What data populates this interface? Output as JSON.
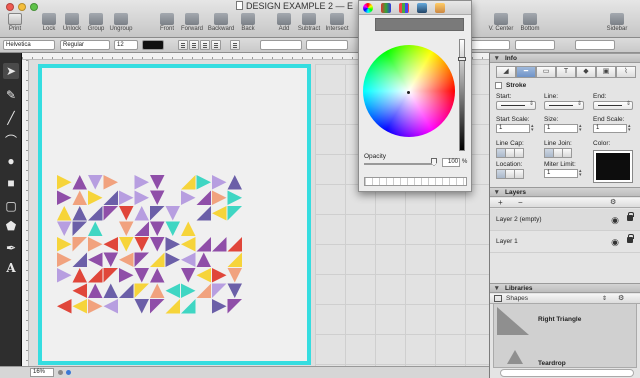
{
  "window": {
    "title": "DESIGN EXAMPLE 2 — E"
  },
  "toolbar": {
    "items": [
      {
        "label": "Print",
        "icon": "printer-icon"
      },
      {
        "label": "Lock",
        "icon": "lock-icon"
      },
      {
        "label": "Unlock",
        "icon": "unlock-icon"
      },
      {
        "label": "Group",
        "icon": "group-icon"
      },
      {
        "label": "Ungroup",
        "icon": "ungroup-icon"
      },
      {
        "label": "Front",
        "icon": "bring-front-icon"
      },
      {
        "label": "Forward",
        "icon": "bring-forward-icon"
      },
      {
        "label": "Backward",
        "icon": "send-backward-icon"
      },
      {
        "label": "Back",
        "icon": "send-back-icon"
      },
      {
        "label": "Add",
        "icon": "union-icon"
      },
      {
        "label": "Subtract",
        "icon": "subtract-icon"
      },
      {
        "label": "Intersect",
        "icon": "intersect-icon"
      },
      {
        "label": "V. Center",
        "icon": "v-center-icon"
      },
      {
        "label": "Bottom",
        "icon": "align-bottom-icon"
      },
      {
        "label": "Sidebar",
        "icon": "sidebar-icon"
      }
    ]
  },
  "formatbar": {
    "font": "Helvetica",
    "style": "Regular",
    "size": "12"
  },
  "tools": [
    {
      "name": "pointer-tool",
      "glyph": "➤"
    },
    {
      "name": "pen-tool",
      "glyph": "✎"
    },
    {
      "name": "line-tool",
      "glyph": "╱"
    },
    {
      "name": "curve-tool",
      "glyph": "⌒"
    },
    {
      "name": "ellipse-tool",
      "glyph": "●"
    },
    {
      "name": "rectangle-tool",
      "glyph": "■"
    },
    {
      "name": "rounded-rect-tool",
      "glyph": "▢"
    },
    {
      "name": "polygon-tool",
      "glyph": "⬟"
    },
    {
      "name": "bezier-tool",
      "glyph": "✒"
    },
    {
      "name": "text-tool",
      "glyph": "A"
    }
  ],
  "statusbar": {
    "zoom": "16%"
  },
  "colors_panel": {
    "opacity_label": "Opacity",
    "opacity_value": "100",
    "opacity_unit": "%",
    "opacity_fraction": 1.0,
    "selected_color": "#000000"
  },
  "inspector": {
    "info_title": "Info",
    "stroke_label": "Stroke",
    "start_label": "Start:",
    "line_label": "Line:",
    "end_label": "End:",
    "start_scale_label": "Start Scale:",
    "start_scale_value": "1",
    "size_label": "Size:",
    "size_value": "1",
    "end_scale_label": "End Scale:",
    "end_scale_value": "1",
    "line_cap_label": "Line Cap:",
    "line_join_label": "Line Join:",
    "color_label": "Color:",
    "location_label": "Location:",
    "miter_limit_label": "Miter Limit:",
    "miter_limit_value": "1",
    "stroke_color": "#0d0d0d",
    "layers_title": "Layers",
    "layers": [
      {
        "name": "Layer 2 (empty)"
      },
      {
        "name": "Layer 1"
      }
    ],
    "libraries_title": "Libraries",
    "library_selected": "Shapes",
    "library_items": [
      "Right Triangle",
      "Teardrop"
    ]
  },
  "pattern": {
    "colors": [
      "#f6d43a",
      "#3fd6c3",
      "#e0463a",
      "#8f4ea8",
      "#b79ee0",
      "#f1a27e",
      "#6b5fa8"
    ]
  }
}
